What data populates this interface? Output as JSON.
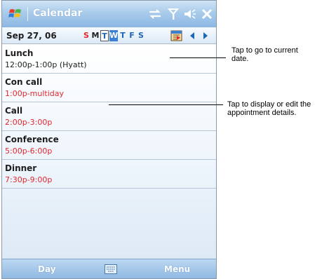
{
  "app": {
    "title": "Calendar",
    "colors": {
      "accent": "#3a7fd1",
      "time_red": "#e0282e",
      "titlebar": "#a9cbeb"
    }
  },
  "status_icons": [
    "start-flag-icon",
    "connectivity-icon",
    "signal-icon",
    "volume-icon",
    "close-icon"
  ],
  "date_strip": {
    "date": "Sep 27, 06",
    "days": [
      "S",
      "M",
      "T",
      "W",
      "T",
      "F",
      "S"
    ],
    "today_index": 2,
    "selected_index": 3
  },
  "appointments": [
    {
      "subject": "Lunch",
      "time": "12:00p-1:00p (Hyatt)"
    },
    {
      "subject": "Con call",
      "time": "1:00p-multiday"
    },
    {
      "subject": "Call",
      "time": "2:00p-3:00p"
    },
    {
      "subject": "Conference",
      "time": "5:00p-6:00p"
    },
    {
      "subject": "Dinner",
      "time": "7:30p-9:00p"
    }
  ],
  "menu": {
    "left": "Day",
    "right": "Menu"
  },
  "callouts": {
    "goto": "Tap to go to current date.",
    "details": "Tap to display or edit the appointment details."
  }
}
